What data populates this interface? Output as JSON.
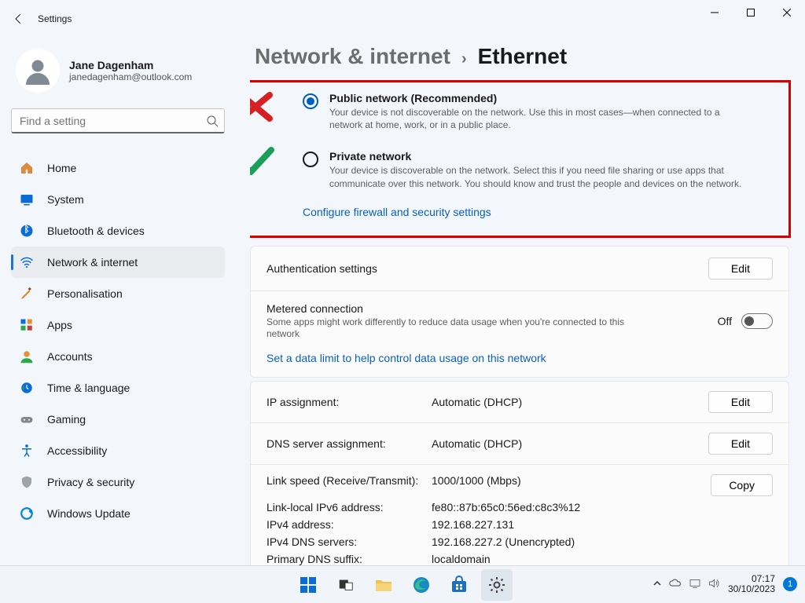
{
  "window_title": "Settings",
  "user": {
    "name": "Jane Dagenham",
    "email": "janedagenham@outlook.com"
  },
  "search": {
    "placeholder": "Find a setting"
  },
  "sidebar": {
    "items": [
      {
        "label": "Home"
      },
      {
        "label": "System"
      },
      {
        "label": "Bluetooth & devices"
      },
      {
        "label": "Network & internet"
      },
      {
        "label": "Personalisation"
      },
      {
        "label": "Apps"
      },
      {
        "label": "Accounts"
      },
      {
        "label": "Time & language"
      },
      {
        "label": "Gaming"
      },
      {
        "label": "Accessibility"
      },
      {
        "label": "Privacy & security"
      },
      {
        "label": "Windows Update"
      }
    ]
  },
  "breadcrumb": {
    "parent": "Network & internet",
    "sep": "›",
    "current": "Ethernet"
  },
  "network_profile": {
    "public_title": "Public network (Recommended)",
    "public_desc": "Your device is not discoverable on the network. Use this in most cases—when connected to a network at home, work, or in a public place.",
    "private_title": "Private network",
    "private_desc": "Your device is discoverable on the network. Select this if you need file sharing or use apps that communicate over this network. You should know and trust the people and devices on the network.",
    "firewall_link": "Configure firewall and security settings"
  },
  "rows": {
    "auth_title": "Authentication settings",
    "edit": "Edit",
    "copy": "Copy",
    "metered_title": "Metered connection",
    "metered_desc": "Some apps might work differently to reduce data usage when you're connected to this network",
    "metered_state": "Off",
    "metered_link": "Set a data limit to help control data usage on this network",
    "ip_title": "IP assignment:",
    "ip_value": "Automatic (DHCP)",
    "dns_title": "DNS server assignment:",
    "dns_value": "Automatic (DHCP)",
    "info": {
      "speed_label": "Link speed (Receive/Transmit):",
      "speed_value": "1000/1000 (Mbps)",
      "llv6_label": "Link-local IPv6 address:",
      "llv6_value": "fe80::87b:65c0:56ed:c8c3%12",
      "ipv4_label": "IPv4 address:",
      "ipv4_value": "192.168.227.131",
      "dns4_label": "IPv4 DNS servers:",
      "dns4_value": "192.168.227.2 (Unencrypted)",
      "suffix_label": "Primary DNS suffix:",
      "suffix_value": "localdomain"
    }
  },
  "tray": {
    "time": "07:17",
    "date": "30/10/2023",
    "count": "1"
  }
}
